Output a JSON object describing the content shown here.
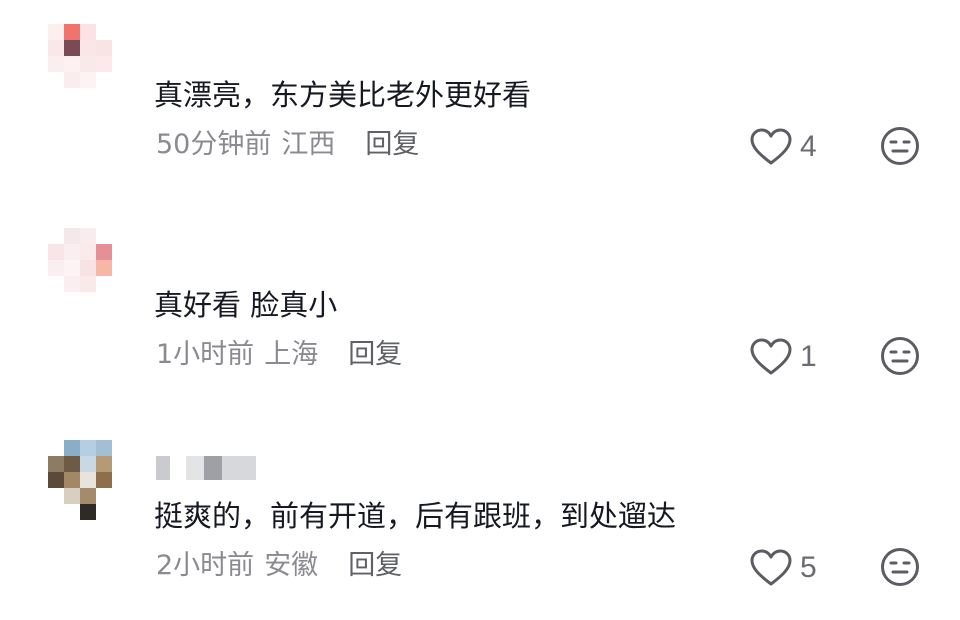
{
  "comments": [
    {
      "text": "真漂亮，东方美比老外更好看",
      "time": "50分钟前",
      "location": "江西",
      "reply_label": "回复",
      "likes": "4",
      "avatar_pixels": [
        [
          "#fbeff0",
          "#f1736d",
          "#fbe3e4",
          "#ffffff",
          "#ffffff"
        ],
        [
          "#fae7e9",
          "#7a4a56",
          "#fae5e7",
          "#f8e3e5",
          "#ffffff"
        ],
        [
          "#fbeef0",
          "#fdf1f2",
          "#fae9eb",
          "#fce9eb",
          "#ffffff"
        ],
        [
          "#ffffff",
          "#fbecee",
          "#fdf3f4",
          "#ffffff",
          "#ffffff"
        ],
        [
          "#ffffff",
          "#ffffff",
          "#ffffff",
          "#ffffff",
          "#ffffff"
        ]
      ]
    },
    {
      "text": "真好看 脸真小",
      "time": "1小时前",
      "location": "上海",
      "reply_label": "回复",
      "likes": "1",
      "avatar_pixels": [
        [
          "#ffffff",
          "#f5e8ea",
          "#f9ecee",
          "#ffffff",
          "#ffffff"
        ],
        [
          "#f8e5e8",
          "#fbeef0",
          "#f9eaec",
          "#e58f97",
          "#ffffff"
        ],
        [
          "#fbeef0",
          "#fdf3f4",
          "#f7e2e4",
          "#f8b7a6",
          "#ffffff"
        ],
        [
          "#ffffff",
          "#fbeef0",
          "#f9e9ea",
          "#ffffff",
          "#ffffff"
        ],
        [
          "#ffffff",
          "#ffffff",
          "#ffffff",
          "#ffffff",
          "#ffffff"
        ]
      ]
    },
    {
      "text": "挺爽的，前有开道，后有跟班，到处遛达",
      "time": "2小时前",
      "location": "安徽",
      "reply_label": "回复",
      "likes": "5",
      "avatar_pixels": [
        [
          "#ffffff",
          "#8aaec8",
          "#b6cee2",
          "#a3bfd4",
          "#ffffff"
        ],
        [
          "#8d7b63",
          "#6d5b47",
          "#c9d8e2",
          "#b59a76",
          "#ffffff"
        ],
        [
          "#5b4a3a",
          "#a38866",
          "#e7e4dc",
          "#8e6e4c",
          "#ffffff"
        ],
        [
          "#ffffff",
          "#d8cfc0",
          "#a48b6c",
          "#ffffff",
          "#ffffff"
        ],
        [
          "#ffffff",
          "#ffffff",
          "#2e2a26",
          "#ffffff",
          "#ffffff"
        ]
      ],
      "username_pixels": [
        "#c9cbcf",
        "#ffffff",
        "#e3e4e6",
        "#9ea0a5",
        "#d7d8db"
      ]
    }
  ],
  "icons": {
    "like": "heart-outline-icon",
    "dislike": "face-neutral-icon"
  },
  "colors": {
    "text": "#161823",
    "meta": "#8a8b91",
    "reply": "#5f6068",
    "icon": "#5c5d63"
  }
}
